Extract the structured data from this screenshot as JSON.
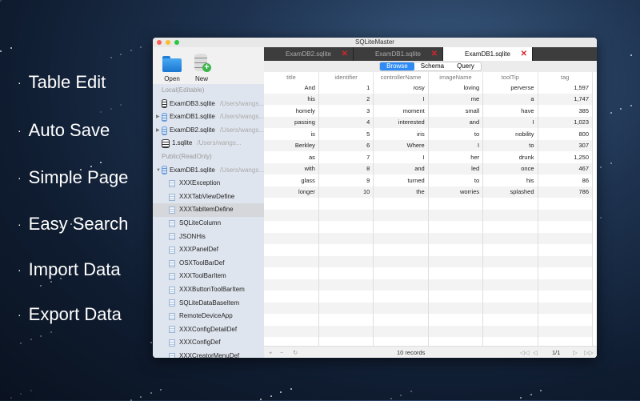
{
  "features": [
    "Table Edit",
    "Auto Save",
    "Simple Page",
    "Easy Search",
    "Import Data",
    "Export Data"
  ],
  "bullet": "·",
  "window": {
    "title": "SQLiteMaster"
  },
  "toolbar": {
    "open": "Open",
    "new": "New"
  },
  "sidebar": {
    "local_label": "Local(Editable)",
    "local": [
      {
        "name": "ExamDB3.sqlite",
        "path": "/Users/wangs...",
        "icon": "db-black",
        "expandable": false
      },
      {
        "name": "ExamDB1.sqlite",
        "path": "/Users/wangs...",
        "icon": "db-blue",
        "expandable": true
      },
      {
        "name": "ExamDB2.sqlite",
        "path": "/Users/wangs...",
        "icon": "db-blue",
        "expandable": true
      },
      {
        "name": "1.sqlite",
        "path": "/Users/wangs...",
        "icon": "db-black",
        "expandable": false
      }
    ],
    "public_label": "Public(ReadOnly)",
    "public_db": {
      "name": "ExamDB1.sqlite",
      "path": "/Users/wangs..."
    },
    "tables": [
      "XXXException",
      "XXXTabViewDefine",
      "XXXTabItemDefine",
      "SQLiteColumn",
      "JSONHis",
      "XXXPanelDef",
      "OSXToolBarDef",
      "XXXToolBarItem",
      "XXXButtonToolBarItem",
      "SQLiteDataBaseItem",
      "RemoteDeviceApp",
      "XXXConfigDetailDef",
      "XXXConfigDef",
      "XXXCreatorMenuDef"
    ],
    "selected_table": "XXXTabItemDefine"
  },
  "tabs": [
    {
      "label": "ExamDB2.sqlite",
      "active": false
    },
    {
      "label": "ExamDB1.sqlite",
      "active": false
    },
    {
      "label": "ExamDB1.sqlite",
      "active": true
    }
  ],
  "close_glyph": "✕",
  "modes": {
    "browse": "Browse",
    "schema": "Schema",
    "query": "Query",
    "selected": "Browse"
  },
  "columns": [
    "title",
    "identifier",
    "controllerName",
    "imageName",
    "toolTip",
    "tag"
  ],
  "rows": [
    [
      "And",
      "1",
      "rosy",
      "loving",
      "perverse",
      "1,597"
    ],
    [
      "his",
      "2",
      "I",
      "me",
      "a",
      "1,747"
    ],
    [
      "homely",
      "3",
      "moment",
      "small",
      "have",
      "385"
    ],
    [
      "passing",
      "4",
      "interested",
      "and",
      "I",
      "1,023"
    ],
    [
      "is",
      "5",
      "iris",
      "to",
      "nobility",
      "800"
    ],
    [
      "Berkley",
      "6",
      "Where",
      "I",
      "to",
      "307"
    ],
    [
      "as",
      "7",
      "I",
      "her",
      "drunk",
      "1,250"
    ],
    [
      "with",
      "8",
      "and",
      "led",
      "once",
      "467"
    ],
    [
      "glass",
      "9",
      "turned",
      "to",
      "his",
      "86"
    ],
    [
      "longer",
      "10",
      "the",
      "worries",
      "splashed",
      "786"
    ]
  ],
  "status": {
    "records": "10 records",
    "page": "1/1"
  },
  "colors": {
    "accent": "#2f8cf5",
    "close": "#d9242a",
    "sidebar": "#dfe5ee"
  }
}
